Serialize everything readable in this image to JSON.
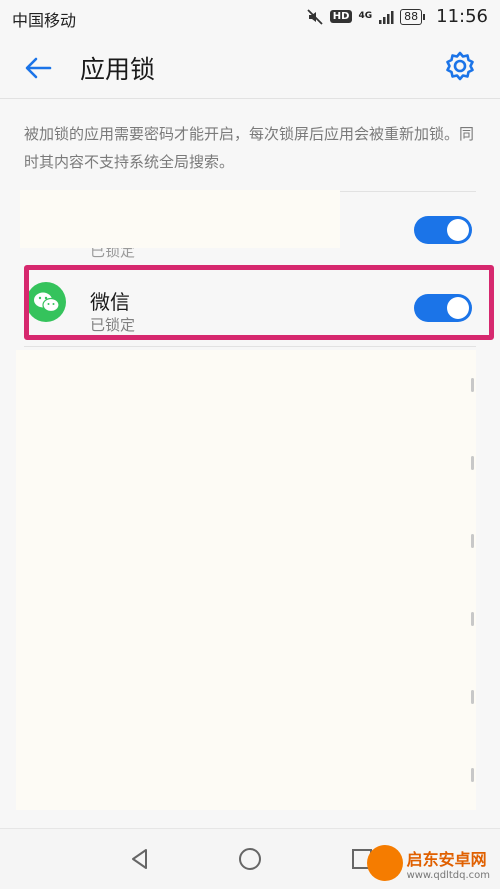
{
  "status_bar": {
    "carrier": "中国移动",
    "hd": "HD",
    "network": "4G",
    "battery": "88",
    "time": "11:56"
  },
  "app_bar": {
    "title": "应用锁"
  },
  "description": "被加锁的应用需要密码才能开启，每次锁屏后应用会被重新加锁。同时其内容不支持系统全局搜索。",
  "apps": [
    {
      "name": "",
      "status": "已锁定",
      "enabled": true
    },
    {
      "name": "微信",
      "status": "已锁定",
      "enabled": true
    }
  ],
  "colors": {
    "toggle_on": "#1b74e8",
    "highlight": "#d6286e",
    "wechat": "#35c35c"
  },
  "watermark": {
    "brand": "启东安卓网",
    "url": "www.qdltdq.com"
  }
}
